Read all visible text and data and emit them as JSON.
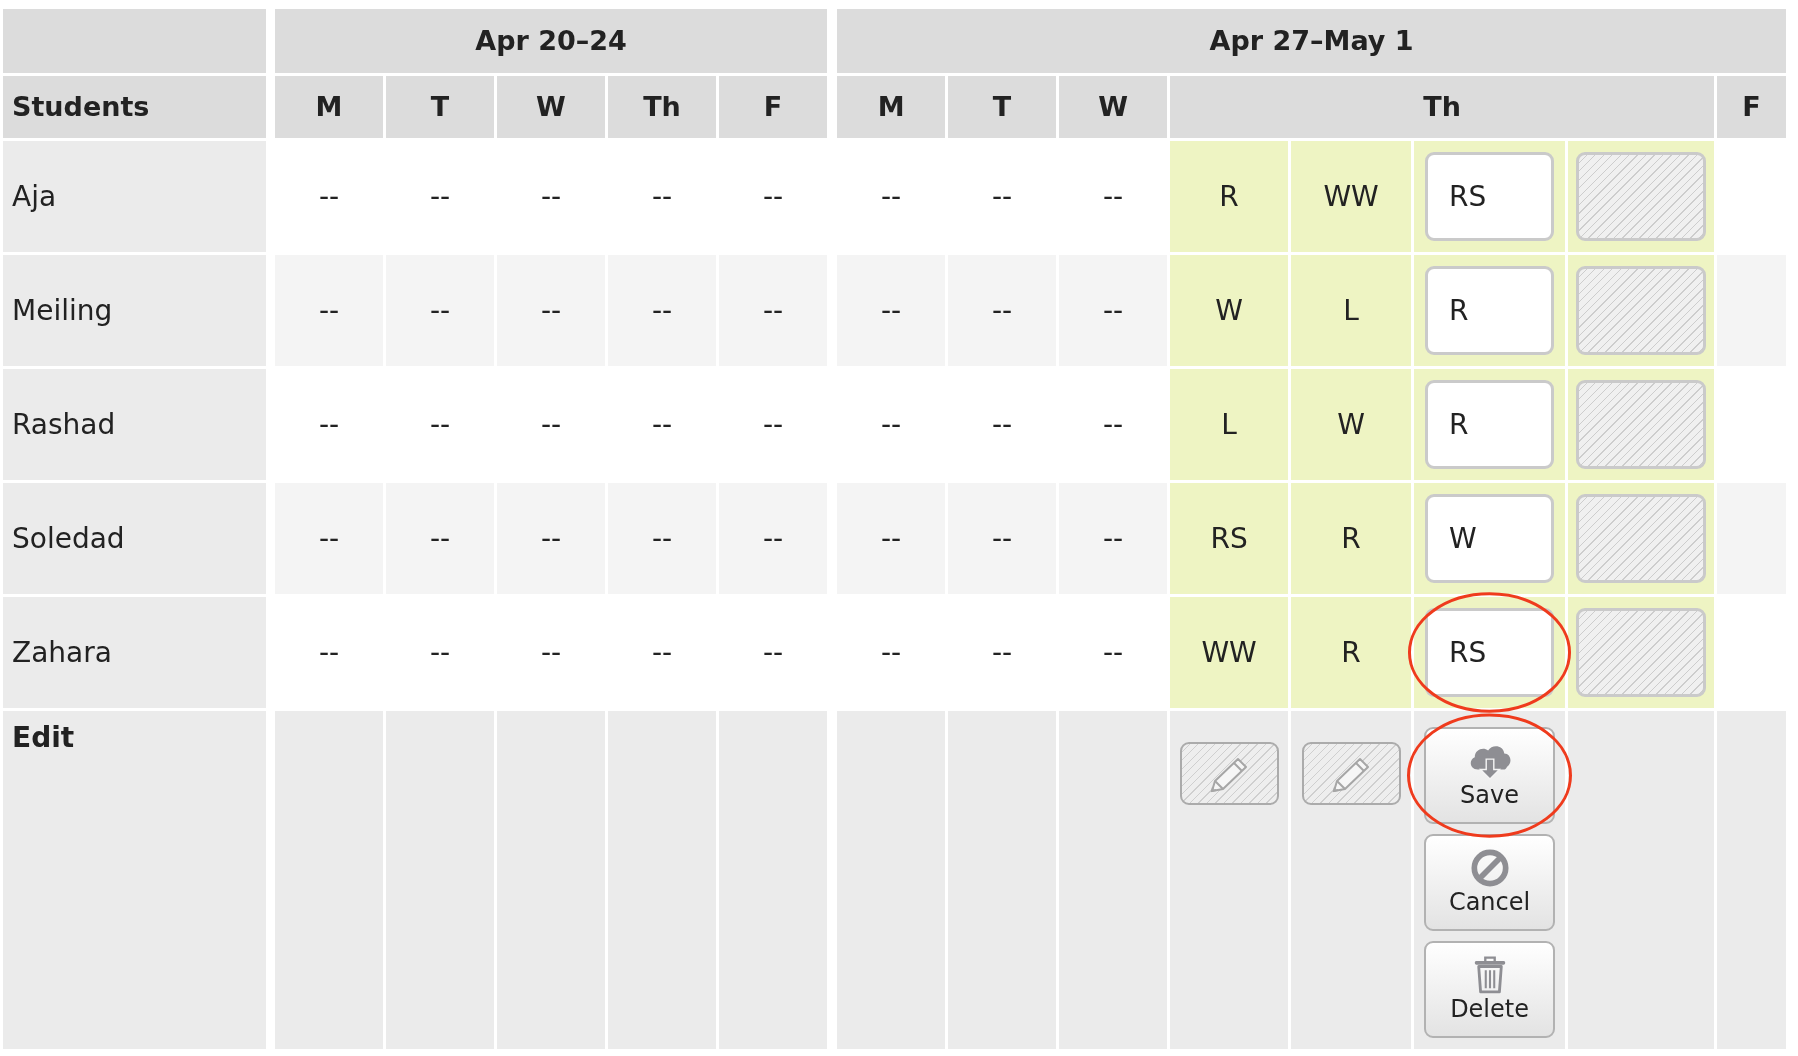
{
  "table": {
    "students_heading": "Students",
    "weeks": [
      {
        "title": "Apr 20–24",
        "days": [
          {
            "label": "M",
            "expanded": false
          },
          {
            "label": "T",
            "expanded": false
          },
          {
            "label": "W",
            "expanded": false
          },
          {
            "label": "Th",
            "expanded": false
          },
          {
            "label": "F",
            "expanded": false
          }
        ]
      },
      {
        "title": "Apr 27–May 1",
        "days": [
          {
            "label": "M",
            "expanded": false
          },
          {
            "label": "T",
            "expanded": false
          },
          {
            "label": "W",
            "expanded": false
          },
          {
            "label": "Th",
            "expanded": true
          },
          {
            "label": "F",
            "expanded": false
          }
        ]
      }
    ],
    "rows": [
      {
        "name": "Aja",
        "weeks": [
          [
            {
              "text": "--"
            },
            {
              "text": "--"
            },
            {
              "text": "--"
            },
            {
              "text": "--"
            },
            {
              "text": "--"
            }
          ],
          [
            {
              "text": "--"
            },
            {
              "text": "--"
            },
            {
              "text": "--"
            },
            {
              "entries": [
                {
                  "kind": "mark",
                  "text": "R"
                },
                {
                  "kind": "mark",
                  "text": "WW"
                },
                {
                  "kind": "input",
                  "value": "RS",
                  "disabled": false,
                  "highlighted": false
                },
                {
                  "kind": "input",
                  "disabled": true,
                  "highlighted": false
                }
              ]
            }
          ]
        ]
      },
      {
        "name": "Meiling",
        "weeks": [
          [
            {
              "text": "--"
            },
            {
              "text": "--"
            },
            {
              "text": "--"
            },
            {
              "text": "--"
            },
            {
              "text": "--"
            }
          ],
          [
            {
              "text": "--"
            },
            {
              "text": "--"
            },
            {
              "text": "--"
            },
            {
              "entries": [
                {
                  "kind": "mark",
                  "text": "W"
                },
                {
                  "kind": "mark",
                  "text": "L"
                },
                {
                  "kind": "input",
                  "value": "R",
                  "disabled": false,
                  "highlighted": false
                },
                {
                  "kind": "input",
                  "disabled": true,
                  "highlighted": false
                }
              ]
            }
          ]
        ]
      },
      {
        "name": "Rashad",
        "weeks": [
          [
            {
              "text": "--"
            },
            {
              "text": "--"
            },
            {
              "text": "--"
            },
            {
              "text": "--"
            },
            {
              "text": "--"
            }
          ],
          [
            {
              "text": "--"
            },
            {
              "text": "--"
            },
            {
              "text": "--"
            },
            {
              "entries": [
                {
                  "kind": "mark",
                  "text": "L"
                },
                {
                  "kind": "mark",
                  "text": "W"
                },
                {
                  "kind": "input",
                  "value": "R",
                  "disabled": false,
                  "highlighted": false
                },
                {
                  "kind": "input",
                  "disabled": true,
                  "highlighted": false
                }
              ]
            }
          ]
        ]
      },
      {
        "name": "Soledad",
        "weeks": [
          [
            {
              "text": "--"
            },
            {
              "text": "--"
            },
            {
              "text": "--"
            },
            {
              "text": "--"
            },
            {
              "text": "--"
            }
          ],
          [
            {
              "text": "--"
            },
            {
              "text": "--"
            },
            {
              "text": "--"
            },
            {
              "entries": [
                {
                  "kind": "mark",
                  "text": "RS"
                },
                {
                  "kind": "mark",
                  "text": "R"
                },
                {
                  "kind": "input",
                  "value": "W",
                  "disabled": false,
                  "highlighted": false
                },
                {
                  "kind": "input",
                  "disabled": true,
                  "highlighted": false
                }
              ]
            }
          ]
        ]
      },
      {
        "name": "Zahara",
        "weeks": [
          [
            {
              "text": "--"
            },
            {
              "text": "--"
            },
            {
              "text": "--"
            },
            {
              "text": "--"
            },
            {
              "text": "--"
            }
          ],
          [
            {
              "text": "--"
            },
            {
              "text": "--"
            },
            {
              "text": "--"
            },
            {
              "entries": [
                {
                  "kind": "mark",
                  "text": "WW"
                },
                {
                  "kind": "mark",
                  "text": "R"
                },
                {
                  "kind": "input",
                  "value": "RS",
                  "disabled": false,
                  "highlighted": true
                },
                {
                  "kind": "input",
                  "disabled": true,
                  "highlighted": false
                }
              ]
            }
          ]
        ]
      }
    ],
    "edit_row": {
      "label": "Edit",
      "controls": [
        {
          "kind": "edit",
          "disabled": true
        },
        {
          "kind": "edit",
          "disabled": true
        },
        {
          "kind": "actions",
          "buttons": [
            {
              "kind": "save",
              "label": "Save",
              "highlighted": true
            },
            {
              "kind": "cancel",
              "label": "Cancel",
              "highlighted": false
            },
            {
              "kind": "delete",
              "label": "Delete",
              "highlighted": false
            }
          ]
        }
      ]
    }
  }
}
